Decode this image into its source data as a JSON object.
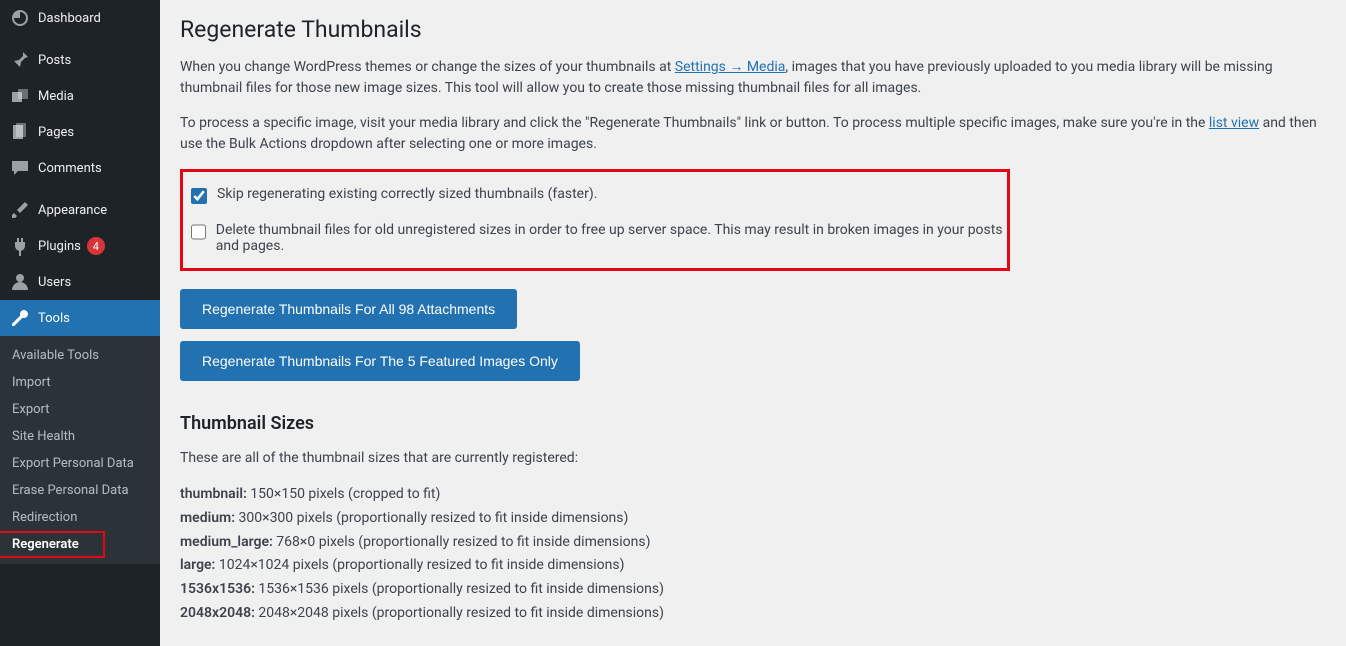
{
  "sidebar": {
    "items": [
      {
        "label": "Dashboard"
      },
      {
        "label": "Posts"
      },
      {
        "label": "Media"
      },
      {
        "label": "Pages"
      },
      {
        "label": "Comments"
      },
      {
        "label": "Appearance"
      },
      {
        "label": "Plugins",
        "badge": "4"
      },
      {
        "label": "Users"
      },
      {
        "label": "Tools"
      }
    ],
    "submenu": [
      {
        "label": "Available Tools"
      },
      {
        "label": "Import"
      },
      {
        "label": "Export"
      },
      {
        "label": "Site Health"
      },
      {
        "label": "Export Personal Data"
      },
      {
        "label": "Erase Personal Data"
      },
      {
        "label": "Redirection"
      },
      {
        "label": "Regenerate"
      }
    ]
  },
  "page": {
    "title": "Regenerate Thumbnails",
    "intro1a": "When you change WordPress themes or change the sizes of your thumbnails at ",
    "intro1_link": "Settings → Media",
    "intro1b": ", images that you have previously uploaded to you media library will be missing thumbnail files for those new image sizes. This tool will allow you to create those missing thumbnail files for all images.",
    "intro2a": "To process a specific image, visit your media library and click the \"Regenerate Thumbnails\" link or button. To process multiple specific images, make sure you're in the ",
    "intro2_link": "list view",
    "intro2b": " and then use the Bulk Actions dropdown after selecting one or more images.",
    "opt_skip": "Skip regenerating existing correctly sized thumbnails (faster).",
    "opt_delete": "Delete thumbnail files for old unregistered sizes in order to free up server space. This may result in broken images in your posts and pages.",
    "btn_all": "Regenerate Thumbnails For All 98 Attachments",
    "btn_featured": "Regenerate Thumbnails For The 5 Featured Images Only",
    "sizes_heading": "Thumbnail Sizes",
    "sizes_intro": "These are all of the thumbnail sizes that are currently registered:",
    "sizes": [
      {
        "name": "thumbnail:",
        "desc": " 150×150 pixels (cropped to fit)"
      },
      {
        "name": "medium:",
        "desc": " 300×300 pixels (proportionally resized to fit inside dimensions)"
      },
      {
        "name": "medium_large:",
        "desc": " 768×0 pixels (proportionally resized to fit inside dimensions)"
      },
      {
        "name": "large:",
        "desc": " 1024×1024 pixels (proportionally resized to fit inside dimensions)"
      },
      {
        "name": "1536x1536:",
        "desc": " 1536×1536 pixels (proportionally resized to fit inside dimensions)"
      },
      {
        "name": "2048x2048:",
        "desc": " 2048×2048 pixels (proportionally resized to fit inside dimensions)"
      }
    ]
  }
}
